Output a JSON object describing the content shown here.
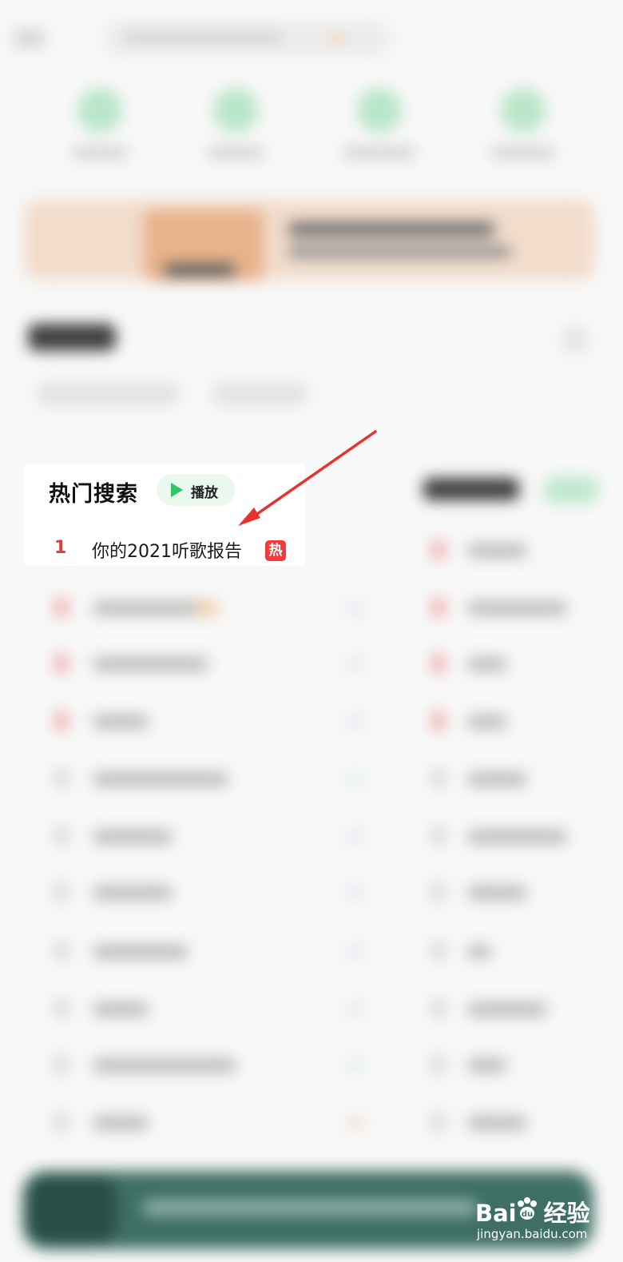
{
  "hot_search": {
    "title": "热门搜索",
    "play_label": "播放",
    "items": [
      {
        "rank": "1",
        "title": "你的2021听歌报告",
        "badge": "热"
      }
    ]
  },
  "watermark": {
    "logo_left": "Bai",
    "logo_right": "经验",
    "url": "jingyan.baidu.com"
  },
  "colors": {
    "accent_green": "#33c46b",
    "hot_red": "#e13a3a",
    "badge_red": "#f23a3a",
    "annotation_arrow": "#e8322d"
  }
}
